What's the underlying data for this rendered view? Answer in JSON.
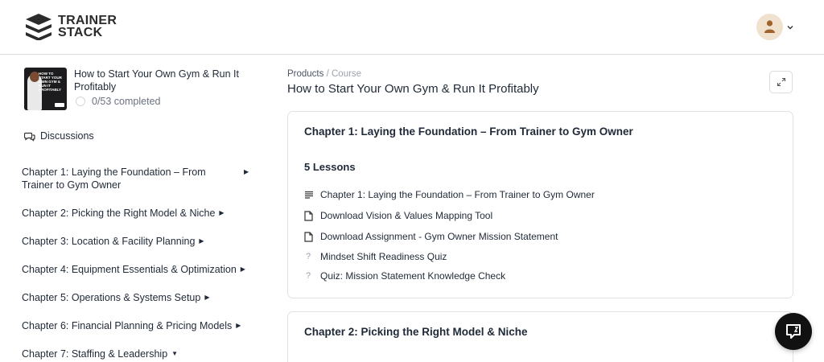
{
  "brand": {
    "line1": "TRAINER",
    "line2": "STACK"
  },
  "user": {
    "avatar_icon": "user-avatar-icon",
    "menu_icon": "chevron-down-icon"
  },
  "course": {
    "title": "How to Start Your Own Gym & Run It Profitably",
    "progress_text": "0/53 completed",
    "thumb_text": "HOW TO START YOUR OWN GYM & RUN IT PROFITABLY"
  },
  "sidebar": {
    "discussions_label": "Discussions",
    "chapters": [
      {
        "label": "Chapter 1: Laying the Foundation – From Trainer to Gym Owner",
        "arrow": "▶"
      },
      {
        "label": "Chapter 2: Picking the Right Model & Niche",
        "arrow": "▶"
      },
      {
        "label": "Chapter 3: Location & Facility Planning",
        "arrow": "▶"
      },
      {
        "label": "Chapter 4: Equipment Essentials & Optimization",
        "arrow": "▶"
      },
      {
        "label": "Chapter 5: Operations & Systems Setup",
        "arrow": "▶"
      },
      {
        "label": "Chapter 6: Financial Planning & Pricing Models",
        "arrow": "▶"
      },
      {
        "label": "Chapter 7: Staffing & Leadership",
        "arrow": "▼"
      }
    ]
  },
  "main": {
    "breadcrumb": {
      "root": "Products",
      "sep": "/",
      "current": "Course"
    },
    "title": "How to Start Your Own Gym & Run It Profitably",
    "chapter_cards": [
      {
        "title": "Chapter 1: Laying the Foundation – From Trainer to Gym Owner",
        "lessons_count": "5 Lessons",
        "lessons": [
          {
            "label": "Chapter 1: Laying the Foundation – From Trainer to Gym Owner",
            "icon": "text-lines-icon"
          },
          {
            "label": "Download Vision & Values Mapping Tool",
            "icon": "document-icon"
          },
          {
            "label": "Download Assignment - Gym Owner Mission Statement",
            "icon": "document-icon"
          },
          {
            "label": "Mindset Shift Readiness Quiz",
            "icon": "question-icon"
          },
          {
            "label": "Quiz: Mission Statement Knowledge Check",
            "icon": "question-icon"
          }
        ]
      },
      {
        "title": "Chapter 2: Picking the Right Model & Niche"
      }
    ]
  }
}
